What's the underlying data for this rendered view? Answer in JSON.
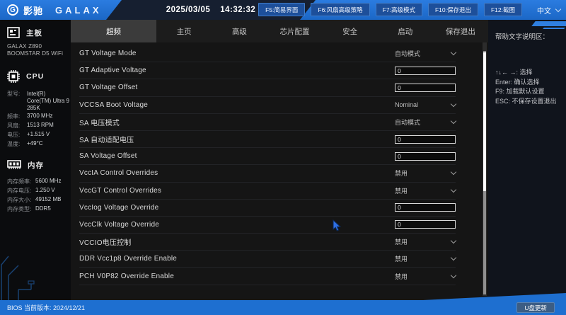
{
  "topbar": {
    "brand_cn": "影驰",
    "brand_en": "GALAX",
    "date": "2025/03/05",
    "time": "14:32:32",
    "buttons": [
      "F5:简易界面",
      "F6:风扇高级策略",
      "F7:高级模式",
      "F10:保存退出",
      "F12:截图"
    ],
    "lang": "中文"
  },
  "tabs": [
    {
      "label": "超频",
      "active": true
    },
    {
      "label": "主页",
      "active": false
    },
    {
      "label": "高级",
      "active": false
    },
    {
      "label": "芯片配置",
      "active": false
    },
    {
      "label": "安全",
      "active": false
    },
    {
      "label": "启动",
      "active": false
    },
    {
      "label": "保存退出",
      "active": false
    }
  ],
  "settings_rows": [
    {
      "label": "GT Voltage Mode",
      "type": "dropdown",
      "value": "自动模式"
    },
    {
      "label": "GT Adaptive Voltage",
      "type": "input",
      "value": "0"
    },
    {
      "label": "GT Voltage Offset",
      "type": "input",
      "value": "0"
    },
    {
      "label": "VCCSA Boot Voltage",
      "type": "dropdown",
      "value": "Nominal"
    },
    {
      "label": "SA 电压模式",
      "type": "dropdown",
      "value": "自动模式"
    },
    {
      "label": "SA 自动适配电压",
      "type": "input",
      "value": "0"
    },
    {
      "label": "SA Voltage Offset",
      "type": "input",
      "value": "0"
    },
    {
      "label": "VccIA Control Overrides",
      "type": "dropdown",
      "value": "禁用"
    },
    {
      "label": "VccGT Control Overrides",
      "type": "dropdown",
      "value": "禁用"
    },
    {
      "label": "VccIog Voltage Override",
      "type": "input",
      "value": "0"
    },
    {
      "label": "VccClk Voltage Override",
      "type": "input",
      "value": "0"
    },
    {
      "label": "VCCIO电压控制",
      "type": "dropdown",
      "value": "禁用"
    },
    {
      "label": "DDR Vcc1p8 Override Enable",
      "type": "dropdown",
      "value": "禁用"
    },
    {
      "label": "PCH V0P82 Override Enable",
      "type": "dropdown",
      "value": "禁用"
    }
  ],
  "sidebar": {
    "board": {
      "title": "主板",
      "name": "GALAX Z890 BOOMSTAR D5 WiFi"
    },
    "cpu": {
      "title": "CPU",
      "stats": [
        {
          "k": "型号:",
          "v": "Intel(R) Core(TM) Ultra 9 285K",
          "tall": true
        },
        {
          "k": "频率:",
          "v": "3700 MHz"
        },
        {
          "k": "风扇:",
          "v": "1513 RPM"
        },
        {
          "k": "电压:",
          "v": "+1.515 V"
        },
        {
          "k": "温度:",
          "v": "+49°C"
        }
      ]
    },
    "memory": {
      "title": "内存",
      "stats": [
        {
          "k": "内存频率:",
          "v": "5600 MHz"
        },
        {
          "k": "内存电压:",
          "v": "1.250 V"
        },
        {
          "k": "内存大小:",
          "v": "49152 MB"
        },
        {
          "k": "内存类型:",
          "v": "DDR5"
        }
      ]
    }
  },
  "help": {
    "title": "帮助文字说明区：",
    "lines": [
      "↑↓← →: 选择",
      "Enter: 确认选择",
      "F9: 加载默认设置",
      "ESC: 不保存设置退出"
    ]
  },
  "bottombar": {
    "version_label": "BIOS 当前版本:  2024/12/21",
    "update_button": "U盘更新"
  },
  "colors": {
    "topbar_blue": "#1e6fd0",
    "date_panel": "#161f30",
    "active_tab": "#3b3b3b",
    "main_bg": "#151515",
    "sidebar_bg": "#0b0c0e",
    "help_bg": "#10141c",
    "accent_blue": "#2f7fe0"
  }
}
